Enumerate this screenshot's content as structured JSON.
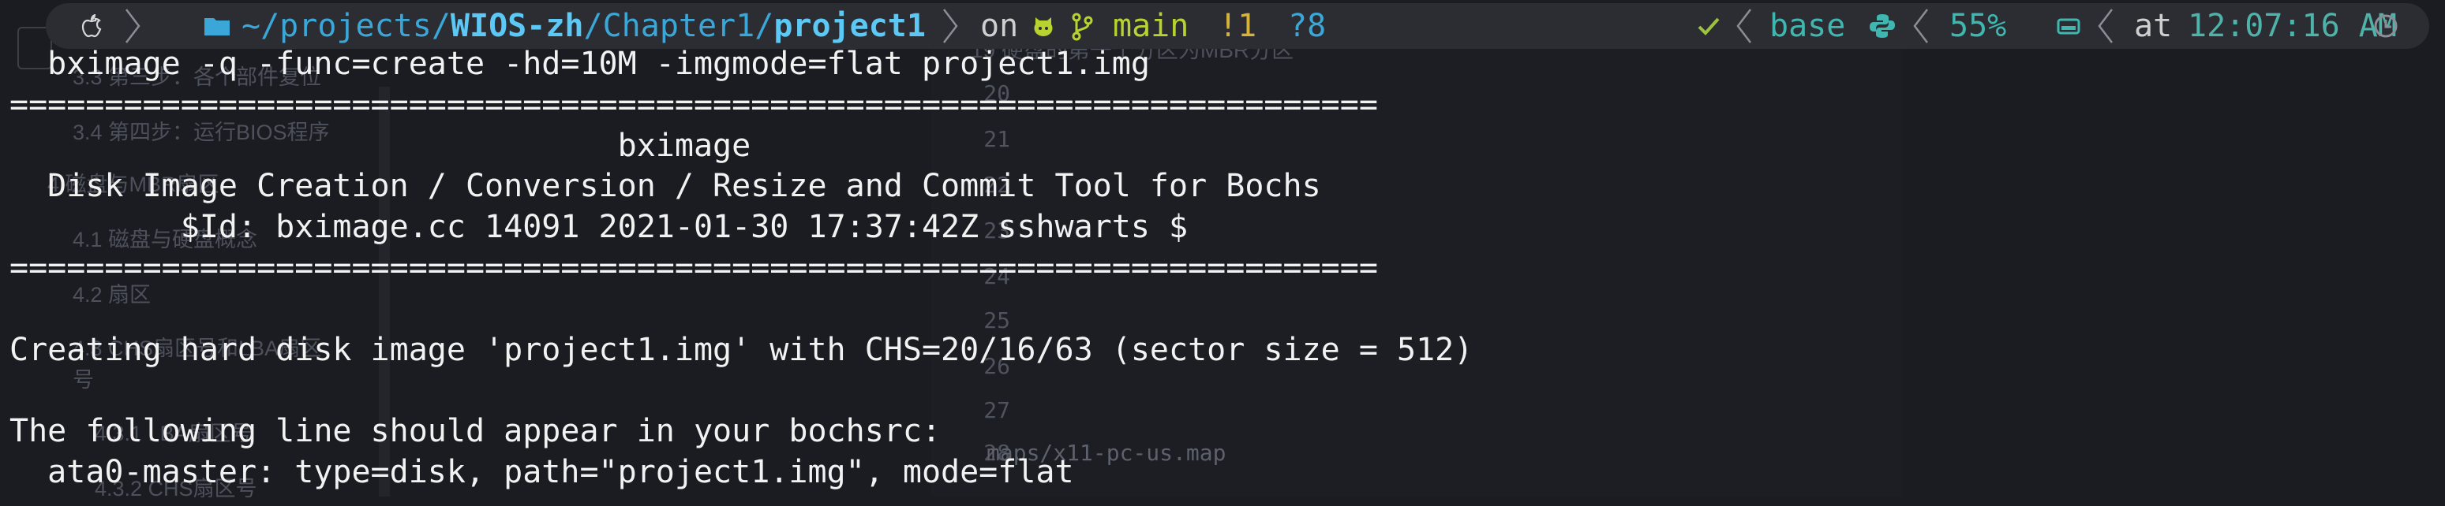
{
  "background_editor": {
    "sidebar_items": [
      "3.3 第三步：各个部件复位",
      "3.4 第四步：运行BIOS程序",
      "4 磁盘与MBR扇区",
      "4.1 磁盘与硬盘概念",
      "4.2 扇区",
      "4.3 CHS扇区号和LBA扇区",
      "号",
      "4.3.1 LBA扇区号",
      "4.3.2 CHS扇区号"
    ],
    "doc_header": "19 硬盘的第一个分区为MBR分区",
    "line_numbers": [
      "20",
      "21",
      "22",
      "23",
      "24",
      "25",
      "26",
      "27",
      "28"
    ],
    "code_line": "maps/x11-pc-us.map"
  },
  "prompt": {
    "path_prefix": "~/projects/",
    "path_repo": "WIOS-zh",
    "path_mid": "/Chapter1/",
    "path_current": "project1",
    "on_label": "on",
    "branch": "main",
    "git_modified": "!1",
    "git_untracked": "?8",
    "conda_env": "base",
    "battery": "55%",
    "at_label": "at",
    "time": "12:07:16 AM",
    "icons": [
      "apple-icon",
      "folder-icon",
      "github-icon",
      "git-branch-icon",
      "check-icon",
      "python-icon",
      "battery-icon",
      "clock-icon"
    ]
  },
  "terminal": {
    "lines": [
      "  bximage -q -func=create -hd=10M -imgmode=flat project1.img",
      "========================================================================",
      "                                bximage",
      "  Disk Image Creation / Conversion / Resize and Commit Tool for Bochs",
      "         $Id: bximage.cc 14091 2021-01-30 17:37:42Z sshwarts $",
      "========================================================================",
      "",
      "Creating hard disk image 'project1.img' with CHS=20/16/63 (sector size = 512)",
      "",
      "The following line should appear in your bochsrc:",
      "  ata0-master: type=disk, path=\"project1.img\", mode=flat"
    ]
  },
  "colors": {
    "bar_bg": "#2b2d33",
    "path": "#3aa7d8",
    "path_bold": "#5cc8f5",
    "branch": "#b8d22f",
    "git_status": "#d7b33a",
    "env": "#3fb7b0",
    "time": "#4fb3a9",
    "text": "#f2f2f2"
  }
}
